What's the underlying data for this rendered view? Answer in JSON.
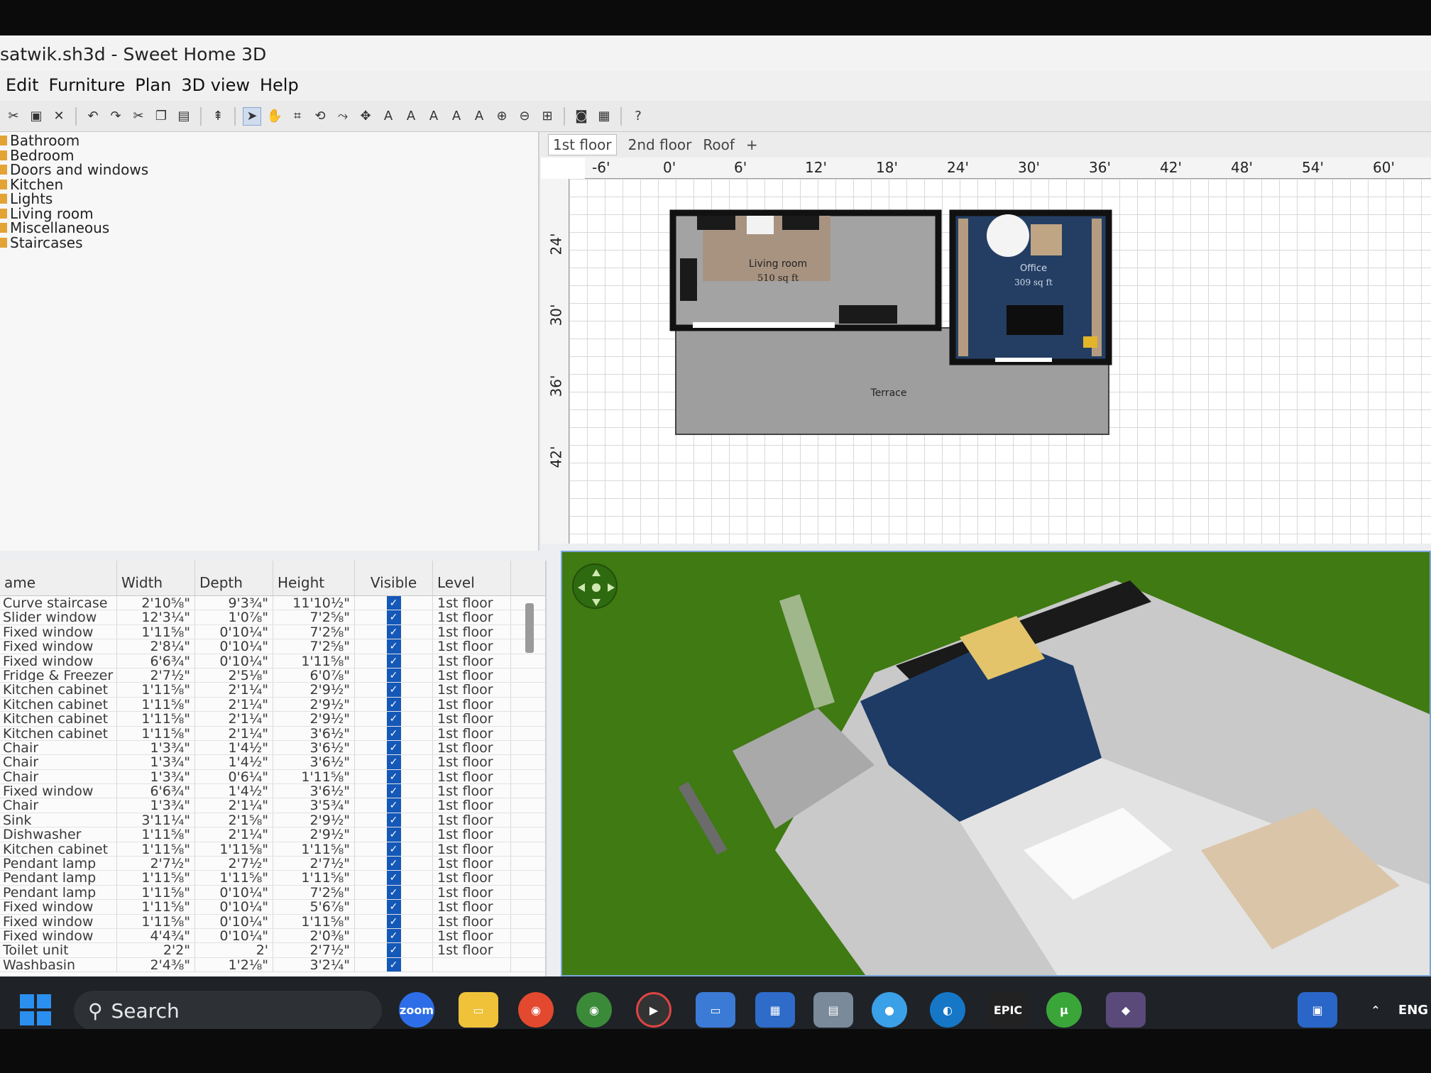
{
  "window": {
    "title": "satwik.sh3d - Sweet Home 3D"
  },
  "menu": [
    "Edit",
    "Furniture",
    "Plan",
    "3D view",
    "Help"
  ],
  "catalog": [
    "Bathroom",
    "Bedroom",
    "Doors and windows",
    "Kitchen",
    "Lights",
    "Living room",
    "Miscellaneous",
    "Staircases"
  ],
  "table": {
    "columns": [
      "ame",
      "Width",
      "Depth",
      "Height",
      "Visible",
      "Level"
    ],
    "rows": [
      [
        "Curve staircase",
        "2'10⅝\"",
        "9'3¾\"",
        "11'10½\"",
        "1st floor"
      ],
      [
        "Slider window",
        "12'3¼\"",
        "1'0⅞\"",
        "7'2⅝\"",
        "1st floor"
      ],
      [
        "Fixed window",
        "1'11⅝\"",
        "0'10¼\"",
        "7'2⅝\"",
        "1st floor"
      ],
      [
        "Fixed window",
        "2'8¼\"",
        "0'10¼\"",
        "7'2⅝\"",
        "1st floor"
      ],
      [
        "Fixed window",
        "6'6¾\"",
        "0'10¼\"",
        "1'11⅝\"",
        "1st floor"
      ],
      [
        "Fridge & Freezer",
        "2'7½\"",
        "2'5⅛\"",
        "6'0⅞\"",
        "1st floor"
      ],
      [
        "Kitchen cabinet",
        "1'11⅝\"",
        "2'1¼\"",
        "2'9½\"",
        "1st floor"
      ],
      [
        "Kitchen cabinet",
        "1'11⅝\"",
        "2'1¼\"",
        "2'9½\"",
        "1st floor"
      ],
      [
        "Kitchen cabinet",
        "1'11⅝\"",
        "2'1¼\"",
        "2'9½\"",
        "1st floor"
      ],
      [
        "Kitchen cabinet",
        "1'11⅝\"",
        "2'1¼\"",
        "3'6½\"",
        "1st floor"
      ],
      [
        "Chair",
        "1'3¾\"",
        "1'4½\"",
        "3'6½\"",
        "1st floor"
      ],
      [
        "Chair",
        "1'3¾\"",
        "1'4½\"",
        "3'6½\"",
        "1st floor"
      ],
      [
        "Chair",
        "1'3¾\"",
        "0'6¼\"",
        "1'11⅝\"",
        "1st floor"
      ],
      [
        "Fixed window",
        "6'6¾\"",
        "1'4½\"",
        "3'6½\"",
        "1st floor"
      ],
      [
        "Chair",
        "1'3¾\"",
        "2'1¼\"",
        "3'5¾\"",
        "1st floor"
      ],
      [
        "Sink",
        "3'11¼\"",
        "2'1⅝\"",
        "2'9½\"",
        "1st floor"
      ],
      [
        "Dishwasher",
        "1'11⅝\"",
        "2'1¼\"",
        "2'9½\"",
        "1st floor"
      ],
      [
        "Kitchen cabinet",
        "1'11⅝\"",
        "1'11⅝\"",
        "1'11⅝\"",
        "1st floor"
      ],
      [
        "Pendant lamp",
        "2'7½\"",
        "2'7½\"",
        "2'7½\"",
        "1st floor"
      ],
      [
        "Pendant lamp",
        "1'11⅝\"",
        "1'11⅝\"",
        "1'11⅝\"",
        "1st floor"
      ],
      [
        "Pendant lamp",
        "1'11⅝\"",
        "0'10¼\"",
        "7'2⅝\"",
        "1st floor"
      ],
      [
        "Fixed window",
        "1'11⅝\"",
        "0'10¼\"",
        "5'6⅞\"",
        "1st floor"
      ],
      [
        "Fixed window",
        "1'11⅝\"",
        "0'10¼\"",
        "1'11⅝\"",
        "1st floor"
      ],
      [
        "Fixed window",
        "4'4¾\"",
        "0'10¼\"",
        "2'0⅜\"",
        "1st floor"
      ],
      [
        "Toilet unit",
        "2'2\"",
        "2'",
        "2'7½\"",
        "1st floor"
      ],
      [
        "Washbasin",
        "2'4⅜\"",
        "1'2⅛\"",
        "3'2¼\"",
        ""
      ]
    ]
  },
  "plan": {
    "tabs": [
      "1st floor",
      "2nd floor",
      "Roof",
      "+"
    ],
    "hruler": [
      "-6'",
      "0'",
      "6'",
      "12'",
      "18'",
      "24'",
      "30'",
      "36'",
      "42'",
      "48'",
      "54'",
      "60'"
    ],
    "vruler": [
      "24'",
      "30'",
      "36'",
      "42'"
    ],
    "rooms": {
      "living_name": "Living room",
      "living_area": "510 sq ft",
      "office_name": "Office",
      "office_area": "309 sq ft",
      "terrace_name": "Terrace"
    }
  },
  "taskbar": {
    "search_label": "Search",
    "zoom_label": "zoom",
    "epic_label": "EPIC",
    "lang": "ENG"
  },
  "icons": {
    "folder": "folder-icon",
    "check": "check-icon",
    "search": "search-icon",
    "windows": "windows-start-icon"
  }
}
